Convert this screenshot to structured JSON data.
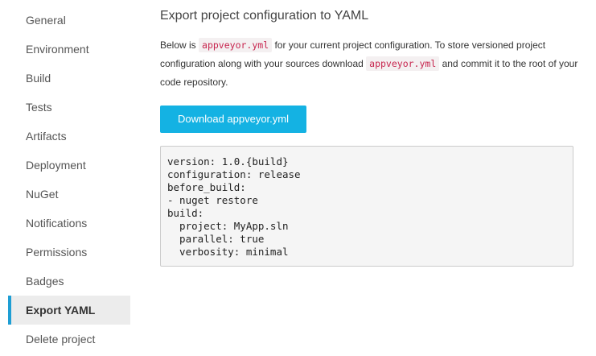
{
  "sidebar": {
    "items": [
      {
        "label": "General",
        "active": false
      },
      {
        "label": "Environment",
        "active": false
      },
      {
        "label": "Build",
        "active": false
      },
      {
        "label": "Tests",
        "active": false
      },
      {
        "label": "Artifacts",
        "active": false
      },
      {
        "label": "Deployment",
        "active": false
      },
      {
        "label": "NuGet",
        "active": false
      },
      {
        "label": "Notifications",
        "active": false
      },
      {
        "label": "Permissions",
        "active": false
      },
      {
        "label": "Badges",
        "active": false
      },
      {
        "label": "Export YAML",
        "active": true
      },
      {
        "label": "Delete project",
        "active": false
      }
    ]
  },
  "main": {
    "title": "Export project configuration to YAML",
    "description": {
      "part1": "Below is ",
      "code1": "appveyor.yml",
      "part2": " for your current project configuration. To store versioned project configuration along with your sources download ",
      "code2": "appveyor.yml",
      "part3": " and commit it to the root of your code repository."
    },
    "download_button": "Download appveyor.yml",
    "yaml": "version: 1.0.{build}\nconfiguration: release\nbefore_build:\n- nuget restore\nbuild:\n  project: MyApp.sln\n  parallel: true\n  verbosity: minimal"
  },
  "colors": {
    "accent": "#1e9ed4",
    "button": "#14b2e3",
    "code_text": "#c7254e",
    "active_bg": "#ececec"
  }
}
